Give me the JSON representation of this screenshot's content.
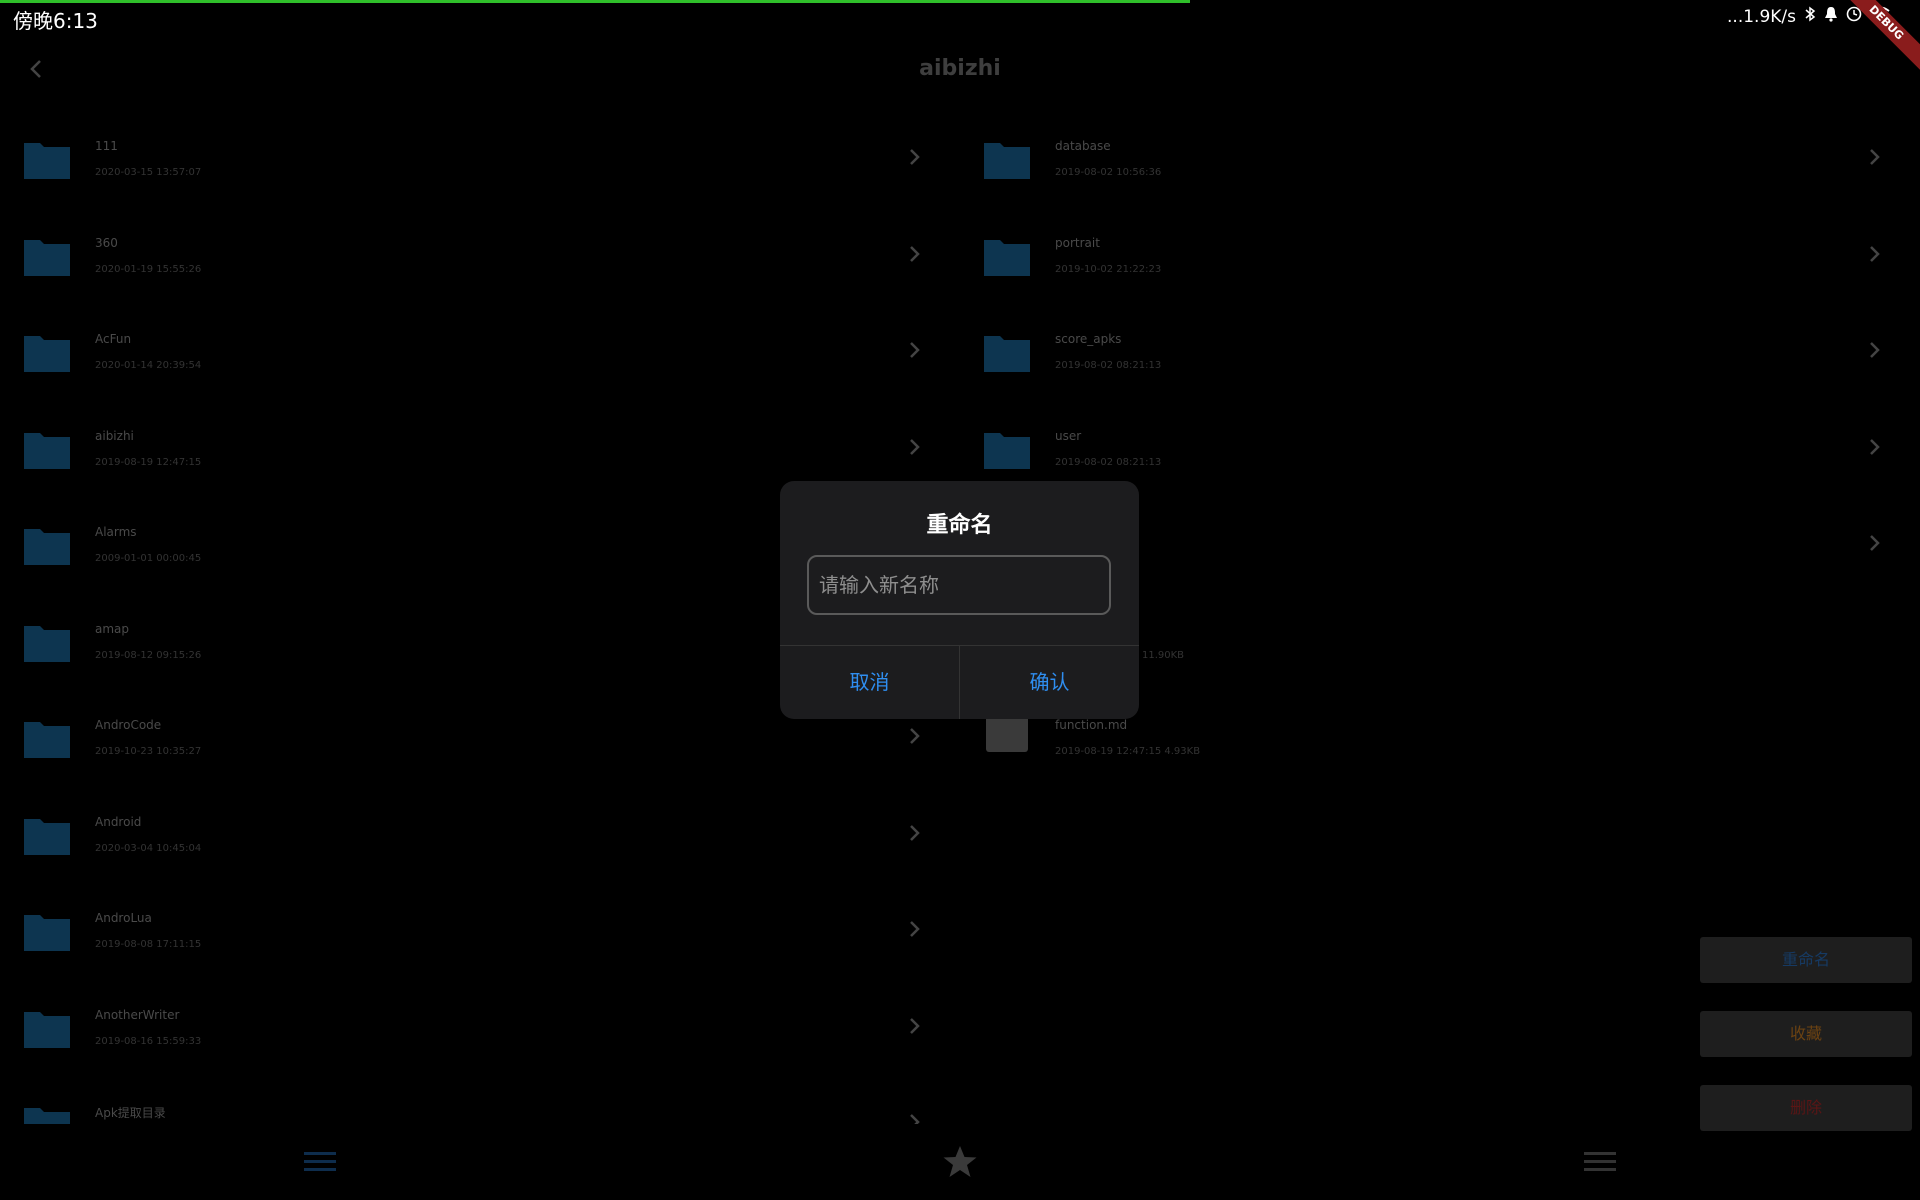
{
  "status_bar": {
    "time": "傍晚6:13",
    "network_speed": "...1.9K/s",
    "debug_label": "DEBUG",
    "progress_color": "#2fbf2a"
  },
  "app_bar": {
    "title": "aibizhi"
  },
  "left_list": [
    {
      "name": "111",
      "meta": "2020-03-15 13:57:07"
    },
    {
      "name": "360",
      "meta": "2020-01-19 15:55:26"
    },
    {
      "name": "AcFun",
      "meta": "2020-01-14 20:39:54"
    },
    {
      "name": "aibizhi",
      "meta": "2019-08-19 12:47:15"
    },
    {
      "name": "Alarms",
      "meta": "2009-01-01 00:00:45"
    },
    {
      "name": "amap",
      "meta": "2019-08-12 09:15:26"
    },
    {
      "name": "AndroCode",
      "meta": "2019-10-23 10:35:27"
    },
    {
      "name": "Android",
      "meta": "2020-03-04 10:45:04"
    },
    {
      "name": "AndroLua",
      "meta": "2019-08-08 17:11:15"
    },
    {
      "name": "AnotherWriter",
      "meta": "2019-08-16 15:59:33"
    },
    {
      "name": "Apk提取目录",
      "meta": ""
    }
  ],
  "right_list": [
    {
      "name": "database",
      "meta": "2019-08-02 10:56:36",
      "kind": "folder"
    },
    {
      "name": "portrait",
      "meta": "2019-10-02 21:22:23",
      "kind": "folder"
    },
    {
      "name": "score_apks",
      "meta": "2019-08-02 08:21:13",
      "kind": "folder"
    },
    {
      "name": "user",
      "meta": "2019-08-02 08:21:13",
      "kind": "folder"
    },
    {
      "name": "",
      "meta": "",
      "kind": "folder-hidden"
    },
    {
      "name": "",
      "meta": "11.90KB",
      "kind": "file-hidden"
    },
    {
      "name": "function.md",
      "meta": "2019-08-19 12:47:15 4.93KB",
      "kind": "file"
    }
  ],
  "actions": {
    "rename": "重命名",
    "favorite": "收藏",
    "delete": "删除"
  },
  "dialog": {
    "title": "重命名",
    "input_placeholder": "请输入新名称",
    "input_value": "",
    "cancel": "取消",
    "confirm": "确认"
  },
  "colors": {
    "accent_blue": "#2f8ef0",
    "folder": "#0d3550",
    "rename_text": "#163a63",
    "favorite_text": "#6b4212",
    "delete_text": "#5b1515"
  }
}
